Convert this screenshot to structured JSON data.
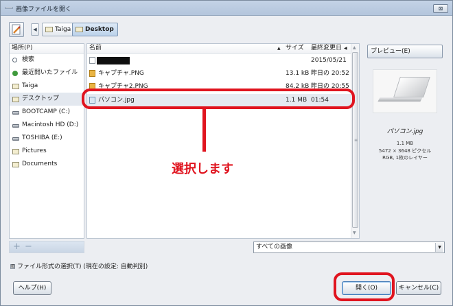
{
  "window": {
    "title": "画像ファイルを開く",
    "close": "⊠"
  },
  "breadcrumbs": [
    {
      "label": "Taiga",
      "active": false
    },
    {
      "label": "Desktop",
      "active": true
    }
  ],
  "places": {
    "header": "場所(P)",
    "items": [
      {
        "label": "検索",
        "icon": "search-icon"
      },
      {
        "label": "最近開いたファイル",
        "icon": "recent-icon"
      },
      {
        "label": "Taiga",
        "icon": "folder-icon"
      },
      {
        "label": "デスクトップ",
        "icon": "folder-icon",
        "selected": true
      },
      {
        "label": "BOOTCAMP (C:)",
        "icon": "drive-icon"
      },
      {
        "label": "Macintosh HD (D:)",
        "icon": "drive-icon"
      },
      {
        "label": "TOSHIBA (E:)",
        "icon": "drive-icon"
      },
      {
        "label": "Pictures",
        "icon": "folder-icon"
      },
      {
        "label": "Documents",
        "icon": "folder-icon"
      }
    ],
    "add": "+",
    "remove": "−"
  },
  "files": {
    "columns": {
      "name": "名前",
      "sort_arrow": "▲",
      "size": "サイズ",
      "modified": "最終変更日",
      "more": "◀"
    },
    "rows": [
      {
        "name": "",
        "size": "",
        "modified": "2015/05/21",
        "icon": "blank-file-icon",
        "redacted": true
      },
      {
        "name": "キャプチャ.PNG",
        "size": "13.1 kB",
        "modified": "昨日の 20:52",
        "icon": "png-file-icon"
      },
      {
        "name": "キャプチャ2.PNG",
        "size": "84.2 kB",
        "modified": "昨日の 20:55",
        "icon": "png-file-icon"
      },
      {
        "name": "パソコン.jpg",
        "size": "1.1 MB",
        "modified": "01:54",
        "icon": "image-file-icon",
        "selected": true
      }
    ],
    "scroll_up": "▲",
    "scroll_down": "▼",
    "grip": "≡"
  },
  "preview": {
    "button": "プレビュー(E)",
    "name": "パソコン.jpg",
    "size": "1.1 MB",
    "dimensions": "5472 × 3648 ピクセル",
    "mode": "RGB, 1枚のレイヤー"
  },
  "filter": {
    "selected": "すべての画像",
    "arrow": "▼"
  },
  "filetype": {
    "toggle": "⊞",
    "label": "ファイル形式の選択(T) (現在の設定: 自動判別)"
  },
  "buttons": {
    "help": "ヘルプ(H)",
    "open": "開く(O)",
    "cancel": "キャンセル(C)"
  },
  "annotation": {
    "text": "選択します",
    "color": "#e0141f"
  }
}
